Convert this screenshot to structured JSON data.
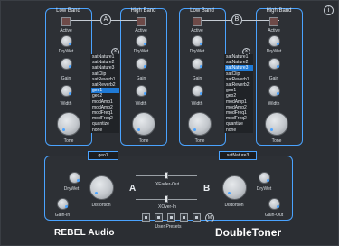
{
  "bands": [
    {
      "label": "Low Band"
    },
    {
      "label": "High Band"
    },
    {
      "label": "Low Band"
    },
    {
      "label": "High Band"
    }
  ],
  "comparators": [
    "A",
    "B"
  ],
  "controls": {
    "active": "Active",
    "drywet": "DryWet",
    "gain": "Gain",
    "width": "Width",
    "tone": "Tone"
  },
  "list_left": {
    "items": [
      "satNature1",
      "satNature2",
      "satNature3",
      "satClip",
      "satReverb1",
      "satReverb2",
      "geo1",
      "geo2",
      "modAmp1",
      "modAmp2",
      "modFreq1",
      "modFreq2",
      "quantize",
      "none"
    ],
    "selected": "geo1"
  },
  "list_right": {
    "items": [
      "satNature1",
      "satNature2",
      "satNature3",
      "satClip",
      "satReverb1",
      "satReverb2",
      "geo1",
      "geo2",
      "modAmp1",
      "modAmp2",
      "modFreq1",
      "modFreq2",
      "quantize",
      "none"
    ],
    "selected": "satNature3"
  },
  "preset_left": "geo1",
  "preset_right": "satNature3",
  "bottom": {
    "drywet_left": "DryWet",
    "gain_in": "Gain-In",
    "distortion_left": "Distortion",
    "fader_label": "XFader-Out",
    "xover_label": "XOver-In",
    "letter_a": "A",
    "letter_b": "B",
    "user_presets": "User Presets",
    "distortion_right": "Distortion",
    "drywet_right": "DryWet",
    "gain_out": "Gain-Out",
    "m_label": "M"
  },
  "brand": {
    "left": "REBEL Audio",
    "right": "DoubleToner"
  },
  "info": "i",
  "close": "×",
  "colors": {
    "accent": "#4aa3ff",
    "selected": "#1f7ad6"
  }
}
